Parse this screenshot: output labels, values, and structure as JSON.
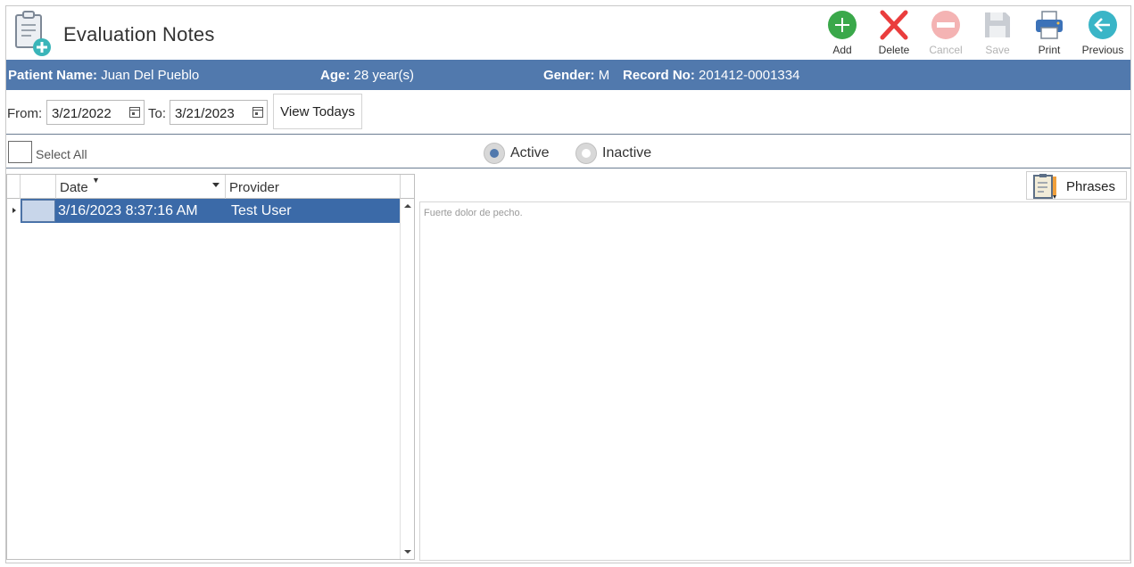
{
  "header": {
    "title": "Evaluation Notes",
    "icon": "clipboard-add-icon"
  },
  "toolbar": {
    "add": "Add",
    "delete": "Delete",
    "cancel": "Cancel",
    "save": "Save",
    "print": "Print",
    "previous": "Previous"
  },
  "patient": {
    "name_label": "Patient Name:",
    "name": "Juan Del Pueblo",
    "age_label": "Age:",
    "age": "28 year(s)",
    "gender_label": "Gender:",
    "gender": "M",
    "record_label": "Record No:",
    "record": "201412-0001334"
  },
  "filter": {
    "from_label": "From:",
    "from_value": "3/21/2022",
    "to_label": "To:",
    "to_value": "3/21/2023",
    "view_todays": "View Todays"
  },
  "selection": {
    "select_all": "Select All",
    "active": "Active",
    "inactive": "Inactive",
    "active_selected": true
  },
  "grid": {
    "columns": [
      "Date",
      "Provider"
    ],
    "rows": [
      {
        "date": "3/16/2023 8:37:16 AM",
        "provider": "Test User"
      }
    ]
  },
  "notes": {
    "phrases": "Phrases",
    "text": "Fuerte dolor de pecho."
  },
  "colors": {
    "patient_bar": "#5179ad",
    "row_selected": "#3b6aa8"
  }
}
